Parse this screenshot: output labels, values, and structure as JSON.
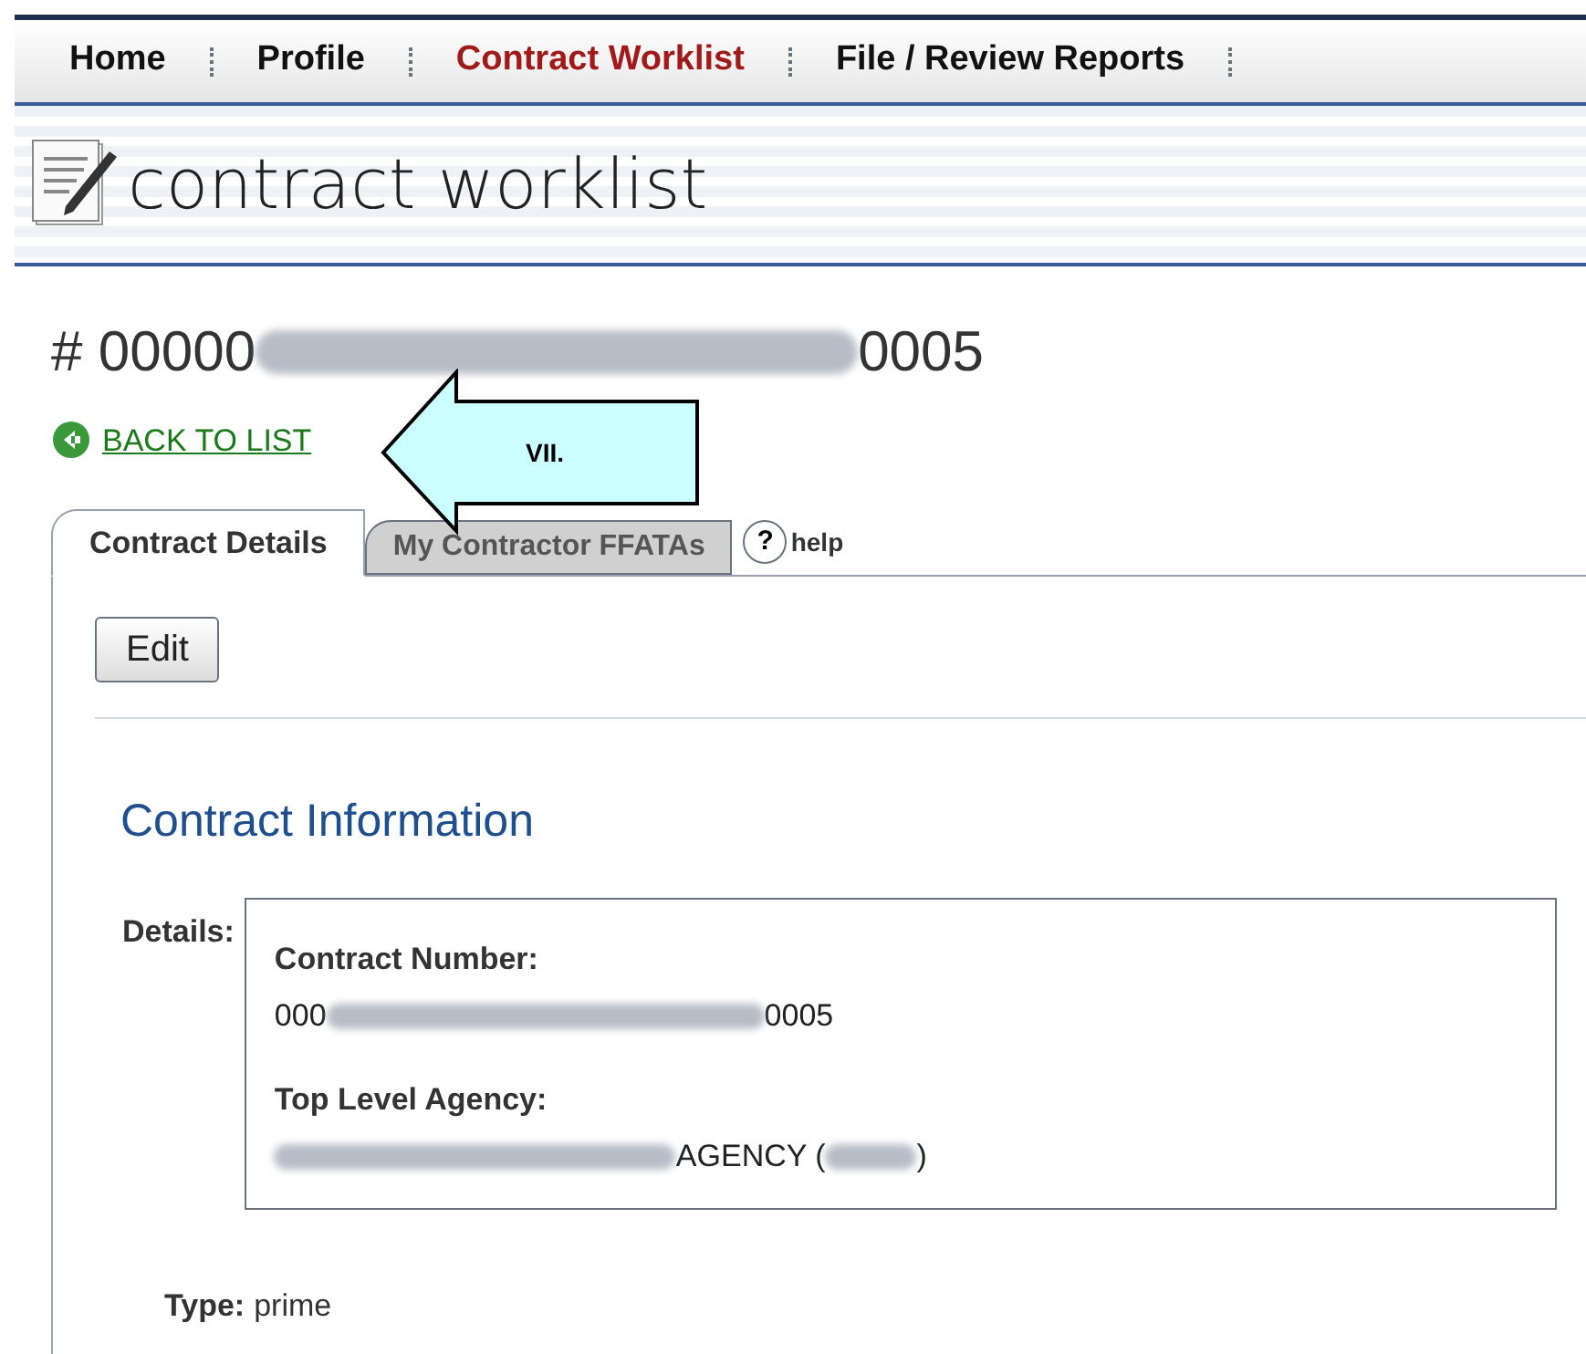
{
  "nav": [
    {
      "label": "Home",
      "selected": false
    },
    {
      "label": "Profile",
      "selected": false
    },
    {
      "label": "Contract Worklist",
      "selected": true
    },
    {
      "label": "File / Review Reports",
      "selected": false
    }
  ],
  "banner": {
    "title": "contract worklist"
  },
  "heading": {
    "prefix": "# 00000",
    "suffix": "0005"
  },
  "back_link": "BACK TO LIST",
  "callout": {
    "label": "VII."
  },
  "tabs": [
    {
      "label": "Contract Details",
      "selected": true
    },
    {
      "label": "My Contractor FFATAs",
      "selected": false
    }
  ],
  "help": {
    "icon": "?",
    "label": "help"
  },
  "edit_button": "Edit",
  "section_title": "Contract Information",
  "details": {
    "label": "Details:",
    "fields": [
      {
        "label": "Contract Number:",
        "value_prefix": "000",
        "value_suffix": "0005"
      },
      {
        "label": "Top Level Agency:",
        "value_suffix": "AGENCY (",
        "value_end": ")"
      }
    ]
  },
  "type": {
    "label": "Type:",
    "value": "prime"
  }
}
